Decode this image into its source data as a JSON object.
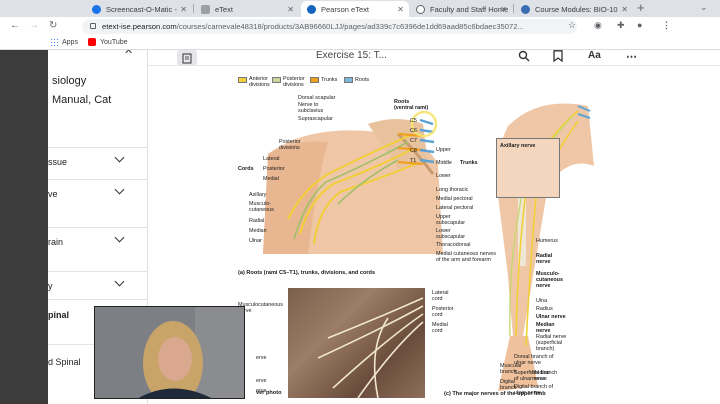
{
  "browser": {
    "tabs": [
      {
        "label": "Screencast-O-Matic -",
        "favicon_color": "#1a73e8",
        "active": false
      },
      {
        "label": "eText",
        "favicon_color": "#9aa0a6",
        "active": false
      },
      {
        "label": "Pearson eText",
        "favicon_color": "#1565c0",
        "active": true
      },
      {
        "label": "Faculty and Staff Home",
        "favicon_color": "#5f6368",
        "active": false
      },
      {
        "label": "Course Modules: BIO-10",
        "favicon_color": "#3b6db3",
        "active": false
      }
    ],
    "new_tab_glyph": "+",
    "url_host": "etext-ise.pearson.com",
    "url_path": "/courses/carnevale48318/products/3AB96660LJJ/pages/ad339c7c6396de1dd69aad85c6bdaec35072...",
    "bookmarks": [
      {
        "label": "Apps",
        "icon": "apps-grid-icon"
      },
      {
        "label": "YouTube",
        "icon": "youtube-icon"
      }
    ]
  },
  "sidebar": {
    "book_title_line1": "siology",
    "book_title_line2": "Manual, Cat",
    "close_glyph": "✕",
    "sections": [
      {
        "label": "ssue"
      },
      {
        "label": "ve"
      },
      {
        "label": "rain"
      },
      {
        "label": "y"
      },
      {
        "label": "pinal"
      },
      {
        "label": "d Spinal"
      }
    ]
  },
  "reader": {
    "exercise_title": "Exercise 15: T...",
    "icons": [
      "search-icon",
      "bookmark-icon",
      "text-size-icon",
      "more-icon"
    ]
  },
  "figure": {
    "legend": [
      {
        "label": "Anterior divisions",
        "color": "#f2cf36"
      },
      {
        "label": "Posterior divisions",
        "color": "#c9d89a"
      },
      {
        "label": "Trunks",
        "color": "#f0a020"
      },
      {
        "label": "Roots",
        "color": "#7fb6d8"
      }
    ],
    "labels_a": {
      "dorsal_scapular": "Dorsal scapular",
      "nerve_to_subclavius": "Nerve to subclavius",
      "suprascapular": "Suprascapular",
      "roots": "Roots (ventral rami)",
      "posterior_divisions": "Posterior divisions",
      "cords": "Cords",
      "lateral": "Lateral",
      "posterior": "Posterior",
      "medial": "Medial",
      "axillary": "Axillary",
      "musculocutaneous": "Musculo-cutaneous",
      "radial": "Radial",
      "median": "Median",
      "ulnar": "Ulnar",
      "upper": "Upper",
      "middle": "Middle",
      "lower": "Lower",
      "trunks": "Trunks",
      "long_thoracic": "Long thoracic",
      "medial_pectoral": "Medial pectoral",
      "lateral_pectoral": "Lateral pectoral",
      "upper_subscapular": "Upper subscapular",
      "lower_subscapular": "Lower subscapular",
      "thoracodorsal": "Thoracodorsal",
      "medial_cutaneous": "Medial cutaneous nerves of the arm and forearm",
      "root_labels": [
        "C5",
        "C6",
        "C7",
        "C8",
        "T1"
      ]
    },
    "caption_a": "(a) Roots (rami C5–T1), trunks, divisions, and cords",
    "labels_b": {
      "musculocutaneous_nerve": "Musculocutaneous nerve",
      "lateral_cord": "Lateral cord",
      "posterior_cord": "Posterior cord",
      "medial_cord": "Medial cord",
      "partial_left": [
        "erve",
        "erve",
        "erve",
        "rachi",
        "ve"
      ]
    },
    "caption_b": "ver photo",
    "labels_c": {
      "axillary_nerve": "Axillary nerve",
      "humerus": "Humerus",
      "radial_nerve": "Radial nerve",
      "musculocutaneous_nerve": "Musculo-cutaneous nerve",
      "ulna": "Ulna",
      "radius": "Radius",
      "ulnar_nerve": "Ulnar nerve",
      "median_nerve": "Median nerve",
      "radial_superficial": "Radial nerve (superficial branch)",
      "dorsal_branch_ulnar": "Dorsal branch of ulnar nerve",
      "superficial_branch_ulnar": "Superficial branch of ulnar nerve",
      "digital_branch_ulnar": "Digital branch of ulnar nerve",
      "muscular_branch": "Muscular branch",
      "digital_branch": "Digital branch",
      "median_nerve_2": "Median nerve"
    },
    "caption_c": "(c) The major nerves of the upper limb"
  }
}
